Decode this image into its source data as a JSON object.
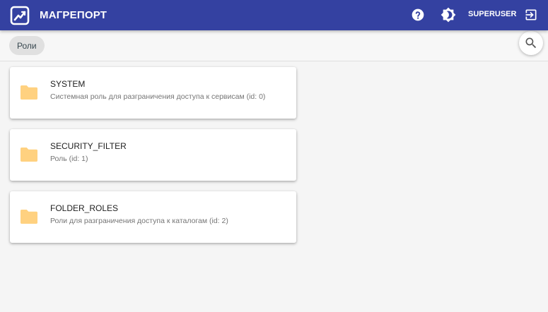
{
  "header": {
    "title": "МАГРЕПОРТ",
    "username": "SUPERUSER"
  },
  "breadcrumb": {
    "label": "Роли"
  },
  "roles": [
    {
      "name": "SYSTEM",
      "description": "Системная роль для разграничения доступа к сервисам (id: 0)"
    },
    {
      "name": "SECURITY_FILTER",
      "description": "Роль (id: 1)"
    },
    {
      "name": "FOLDER_ROLES",
      "description": "Роли для разграничения доступа к каталогам (id: 2)"
    }
  ],
  "colors": {
    "appbar": "#3441a1",
    "folder": "#ffd180",
    "background": "#f5f5f5"
  },
  "icons": {
    "logo": "chart-logo-icon",
    "help": "help-circle-icon",
    "theme": "brightness-icon",
    "logout": "logout-icon",
    "search": "search-icon",
    "folder": "folder-icon"
  }
}
